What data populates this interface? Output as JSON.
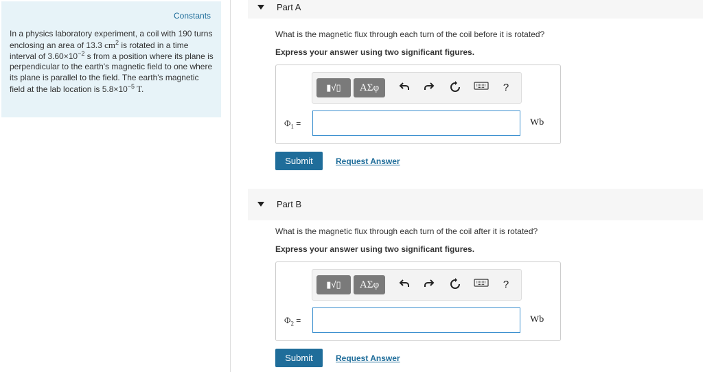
{
  "left_panel": {
    "constants_label": "Constants",
    "problem": {
      "t1": "In a physics laboratory experiment, a coil with 190 turns enclosing an area of 13.3 ",
      "area_unit": "cm",
      "area_exp": "2",
      "t2": " is rotated in a time interval of 3.60×10",
      "time_exp": "−2",
      "t3": " s from a position where its plane is perpendicular to the earth's magnetic field to one where its plane is parallel to the field. The earth's magnetic field at the lab location is 5.8×10",
      "field_exp": "−5",
      "field_unit": " T."
    }
  },
  "toolbar": {
    "template_label": "▮√▯",
    "greek_label": "ΑΣφ",
    "undo_icon": "undo-icon",
    "redo_icon": "redo-icon",
    "reset_icon": "reset-icon",
    "keyboard_icon": "keyboard-icon",
    "help_label": "?"
  },
  "parts": [
    {
      "title": "Part A",
      "question": "What is the magnetic flux through each turn of the coil before it is rotated?",
      "instruction": "Express your answer using two significant figures.",
      "variable": "Φ",
      "subscript": "1",
      "equals": "=",
      "value": "",
      "unit": "Wb",
      "submit_label": "Submit",
      "request_label": "Request Answer"
    },
    {
      "title": "Part B",
      "question": "What is the magnetic flux through each turn of the coil after it is rotated?",
      "instruction": "Express your answer using two significant figures.",
      "variable": "Φ",
      "subscript": "2",
      "equals": "=",
      "value": "",
      "unit": "Wb",
      "submit_label": "Submit",
      "request_label": "Request Answer"
    }
  ]
}
